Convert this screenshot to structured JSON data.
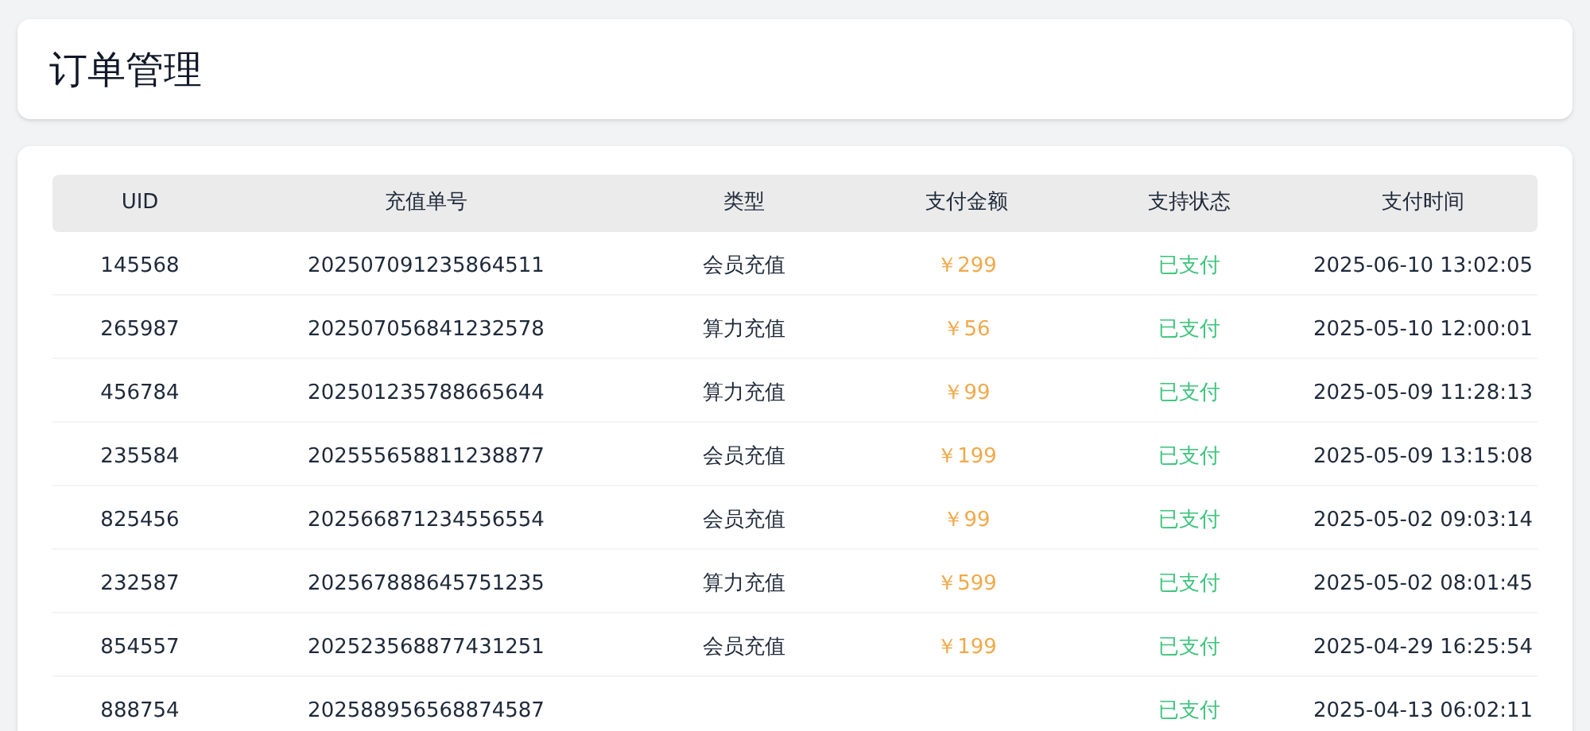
{
  "page_title": "订单管理",
  "table": {
    "columns": [
      "UID",
      "充值单号",
      "类型",
      "支付金额",
      "支持状态",
      "支付时间"
    ],
    "rows": [
      {
        "uid": "145568",
        "order_no": "202507091235864511",
        "type": "会员充值",
        "amount": "￥299",
        "status": "已支付",
        "time": "2025-06-10 13:02:05"
      },
      {
        "uid": "265987",
        "order_no": "202507056841232578",
        "type": "算力充值",
        "amount": "￥56",
        "status": "已支付",
        "time": "2025-05-10 12:00:01"
      },
      {
        "uid": "456784",
        "order_no": "202501235788665644",
        "type": "算力充值",
        "amount": "￥99",
        "status": "已支付",
        "time": "2025-05-09 11:28:13"
      },
      {
        "uid": "235584",
        "order_no": "202555658811238877",
        "type": "会员充值",
        "amount": "￥199",
        "status": "已支付",
        "time": "2025-05-09 13:15:08"
      },
      {
        "uid": "825456",
        "order_no": "202566871234556554",
        "type": "会员充值",
        "amount": "￥99",
        "status": "已支付",
        "time": "2025-05-02 09:03:14"
      },
      {
        "uid": "232587",
        "order_no": "202567888645751235",
        "type": "算力充值",
        "amount": "￥599",
        "status": "已支付",
        "time": "2025-05-02 08:01:45"
      },
      {
        "uid": "854557",
        "order_no": "202523568877431251",
        "type": "会员充值",
        "amount": "￥199",
        "status": "已支付",
        "time": "2025-04-29 16:25:54"
      },
      {
        "uid": "888754",
        "order_no": "202588956568874587",
        "status": "已支付",
        "time": "2025-04-13 06:02:11"
      }
    ]
  }
}
